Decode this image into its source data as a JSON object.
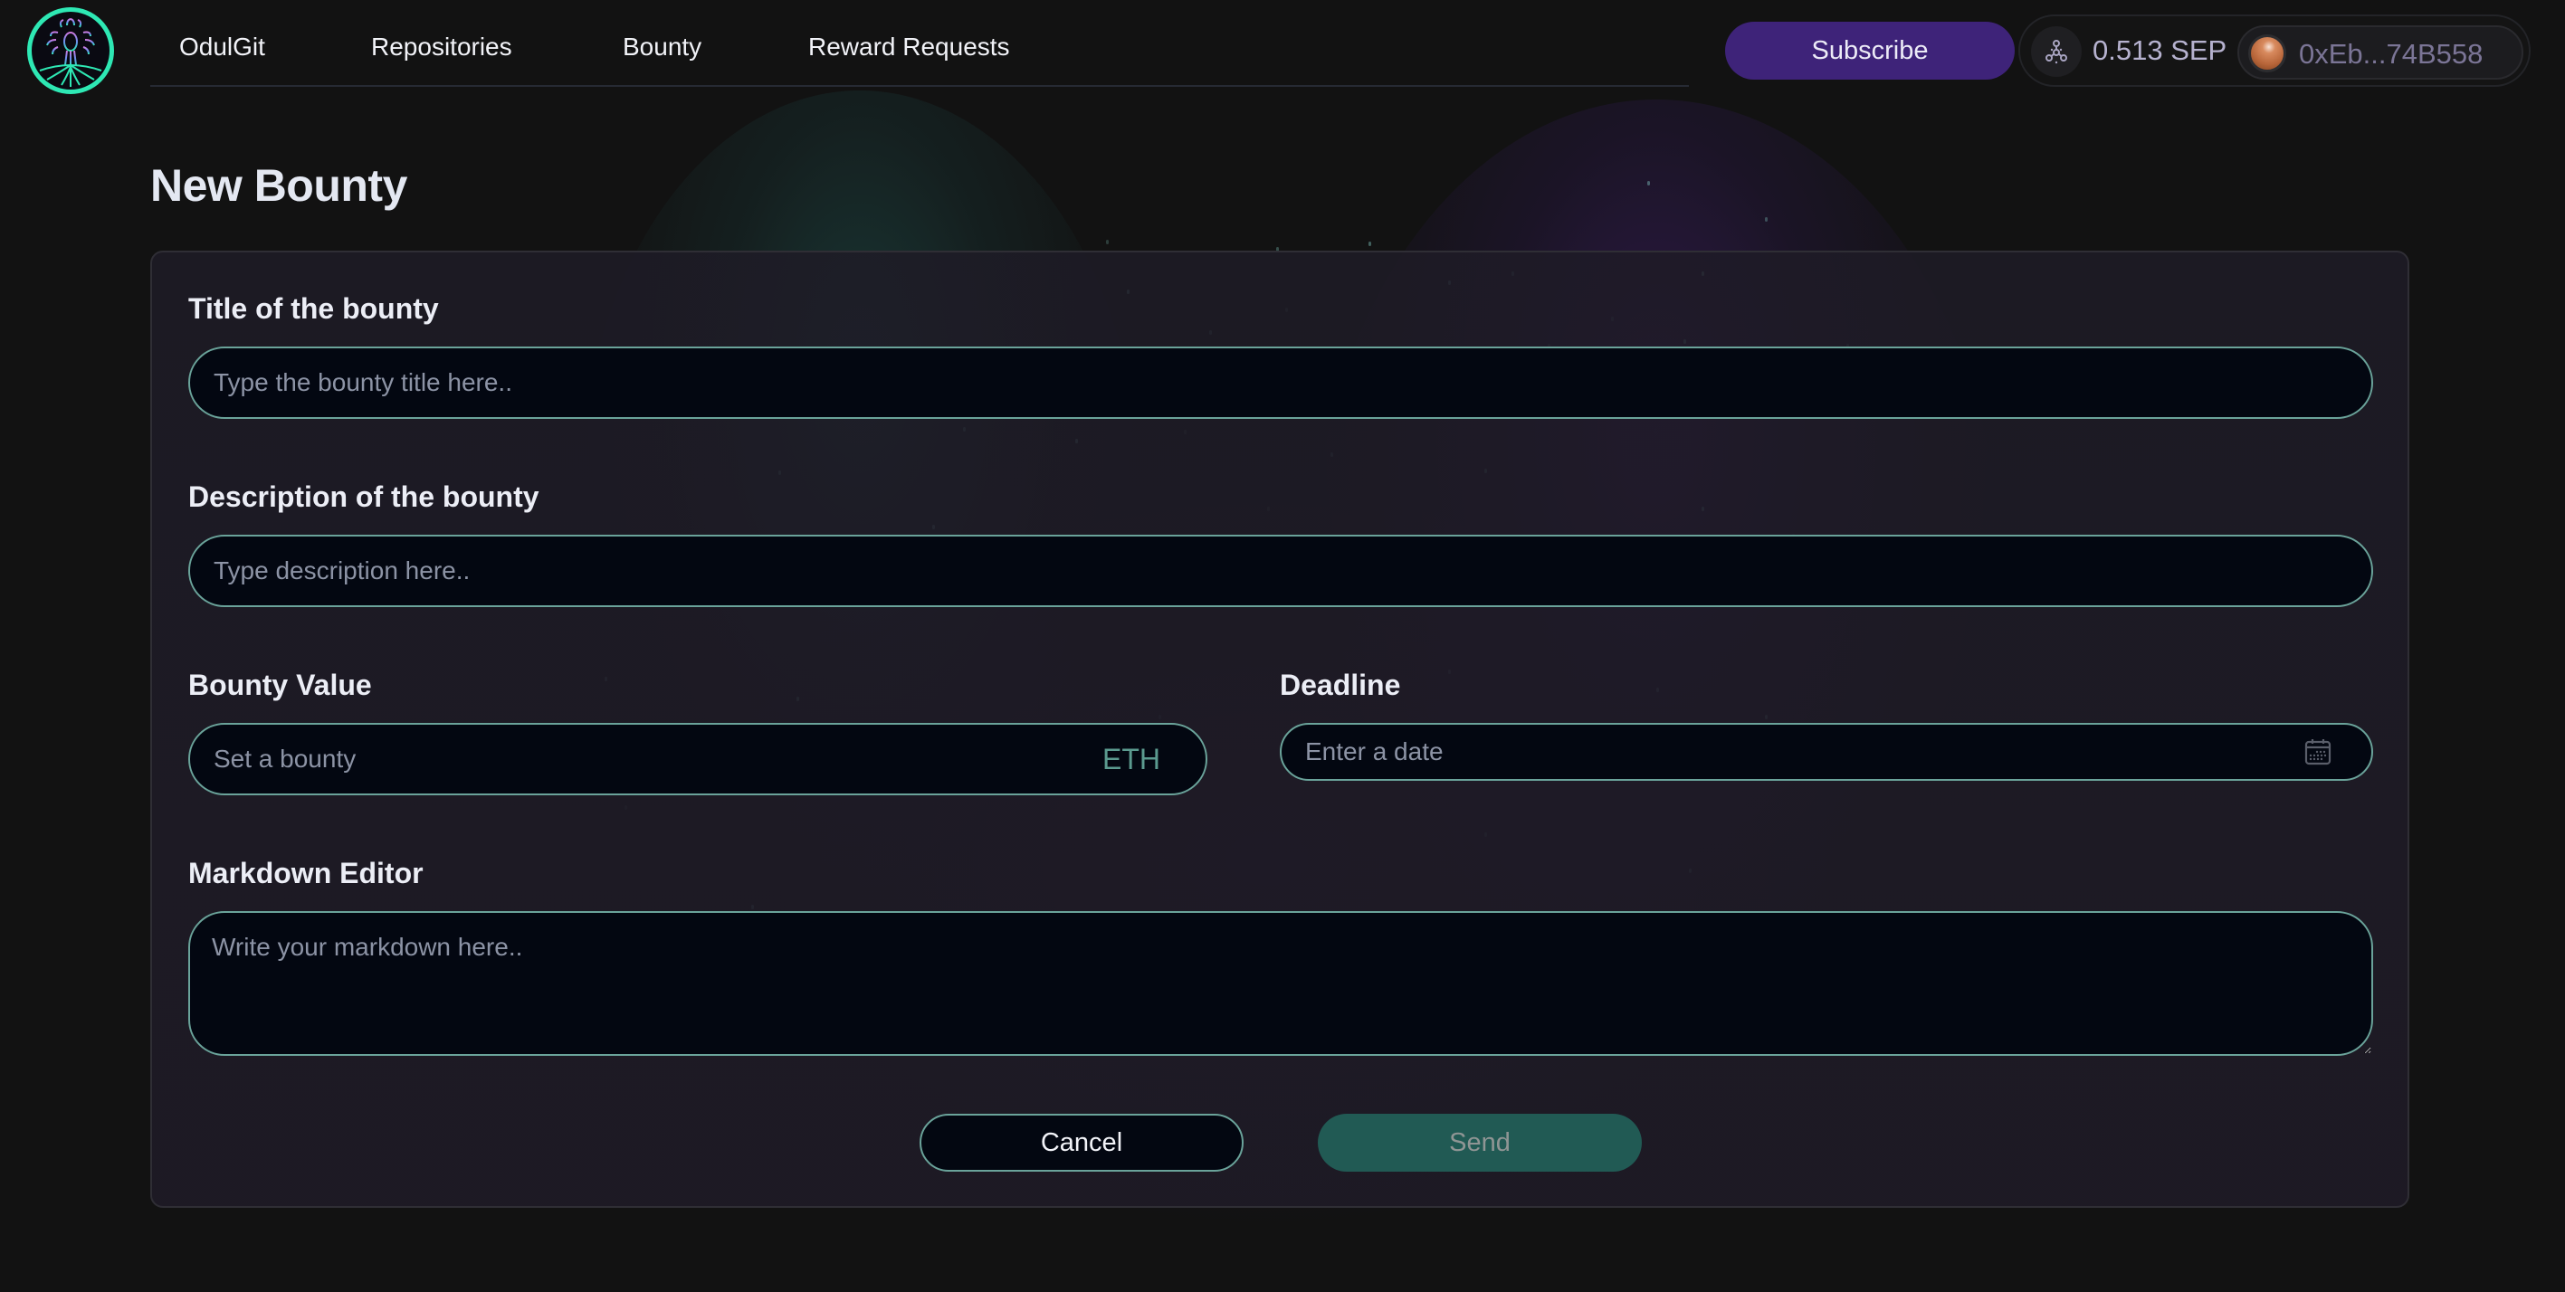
{
  "header": {
    "logo_alt": "OdulGit logo",
    "nav": [
      {
        "label": "OdulGit"
      },
      {
        "label": "Repositories"
      },
      {
        "label": "Bounty"
      },
      {
        "label": "Reward Requests"
      }
    ],
    "subscribe_label": "Subscribe",
    "wallet": {
      "network_icon": "network-icon",
      "balance": "0.513 SEP",
      "address": "0xEb...74B558"
    }
  },
  "page": {
    "title": "New Bounty"
  },
  "form": {
    "title_field": {
      "label": "Title of the bounty",
      "placeholder": "Type the bounty title here..",
      "value": ""
    },
    "description_field": {
      "label": "Description of the bounty",
      "placeholder": "Type description here..",
      "value": ""
    },
    "bounty_value_field": {
      "label": "Bounty Value",
      "placeholder": "Set a bounty",
      "value": "",
      "unit": "ETH"
    },
    "deadline_field": {
      "label": "Deadline",
      "placeholder": "Enter a date",
      "value": ""
    },
    "markdown_field": {
      "label": "Markdown Editor",
      "placeholder": "Write your markdown here..",
      "value": ""
    },
    "cancel_label": "Cancel",
    "send_label": "Send"
  },
  "colors": {
    "accent_teal": "#2ee8b4",
    "input_border": "#6aa39a",
    "subscribe_bg": "#3e2379",
    "send_bg": "#215a54"
  }
}
